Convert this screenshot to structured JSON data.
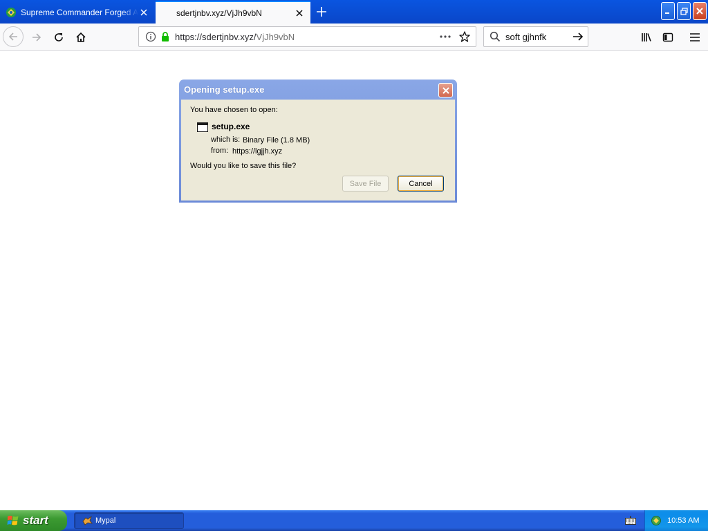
{
  "browser": {
    "tabs": [
      {
        "title": "Supreme Commander Forged Alliance",
        "active": false
      },
      {
        "title": "sdertjnbv.xyz/VjJh9vbN",
        "active": true
      }
    ],
    "url": {
      "host_part": "https://sdertjnbv.xyz/",
      "path_part": "VjJh9vbN"
    },
    "search": {
      "value": "soft gjhnfk"
    }
  },
  "dialog": {
    "title": "Opening setup.exe",
    "intro": "You have chosen to open:",
    "file_name": "setup.exe",
    "which_label": "which is:",
    "which_value": "Binary File (1.8 MB)",
    "from_label": "from:",
    "from_value": "https://lgjjh.xyz",
    "question": "Would you like to save this file?",
    "save_label": "Save File",
    "cancel_label": "Cancel",
    "save_enabled": false
  },
  "taskbar": {
    "start_label": "start",
    "tasks": [
      {
        "label": "Mypal"
      }
    ],
    "clock": "10:53 AM"
  },
  "colors": {
    "titlebar": "#0a4fd6",
    "dialog_frame": "#7a98e0",
    "dialog_body": "#ece9d8",
    "taskbar": "#245edb",
    "start_button": "#3c9a32",
    "lock_green": "#12bc00"
  },
  "icons": [
    "supreme-commander-favicon",
    "close-icon",
    "plus-icon",
    "minimize-icon",
    "restore-icon",
    "back-arrow-icon",
    "forward-arrow-icon",
    "reload-icon",
    "home-icon",
    "info-icon",
    "lock-icon",
    "ellipsis-icon",
    "star-icon",
    "search-icon",
    "arrow-right-icon",
    "library-icon",
    "sidebar-icon",
    "hamburger-menu-icon",
    "window-file-icon",
    "windows-logo-icon",
    "mypal-icon",
    "keyboard-icon",
    "network-icon"
  ]
}
